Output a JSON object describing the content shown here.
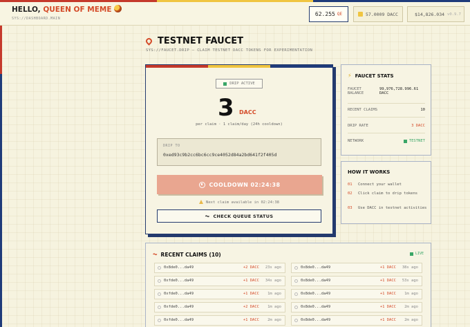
{
  "colors": {
    "red": "#c5392b",
    "navy": "#1f3b7a",
    "yellow": "#f0c540",
    "orange": "#d44a28",
    "green": "#3aa667"
  },
  "header": {
    "greeting": "HELLO, ",
    "user_name": "QUEEN OF MEME",
    "path": "SYS://DASHBOARD.MAIN",
    "balance_value": "62.255",
    "balance_unit": "QE",
    "dacc_balance": "57.0009 DACC",
    "token_amount": "$14,826.034",
    "version": "v0.9.7"
  },
  "page": {
    "title": "TESTNET FAUCET",
    "subtitle": "SYS://FAUCET.DRIP — CLAIM TESTNET DACC TOKENS FOR EXPERIMENTATION"
  },
  "faucet": {
    "status_badge": "DRIP ACTIVE",
    "amount": "3",
    "amount_unit": "DACC",
    "per_claim": "per claim · 1 claim/day (24h cooldown)",
    "drip_to_label": "DRIP TO",
    "address": "0xed93c9b2cc6bc6cc9ce4052d84a2bd641f2f405d",
    "cooldown_button": "COOLDOWN 02:24:38",
    "next_claim": "Next claim available in 02:24:38",
    "queue_button": "CHECK QUEUE STATUS"
  },
  "stats": {
    "title": "FAUCET STATS",
    "rows": [
      {
        "label_line1": "FAUCET",
        "label_line2": "BALANCE",
        "value_line1": "99,976,728.996.61",
        "value_line2": "DACC"
      },
      {
        "label": "RECENT CLAIMS",
        "value": "10"
      },
      {
        "label": "DRIP RATE",
        "value": "3 DACC"
      },
      {
        "label": "NETWORK",
        "value": "TESTNET"
      }
    ]
  },
  "how_it_works": {
    "title": "HOW IT WORKS",
    "steps": [
      {
        "num": "01",
        "text": "Connect your wallet"
      },
      {
        "num": "02",
        "text": "Click claim to drip tokens"
      },
      {
        "num": "03",
        "text": "Use DACC in testnet activities"
      }
    ]
  },
  "recent_claims": {
    "title": "RECENT CLAIMS (10)",
    "live_label": "LIVE",
    "left": [
      {
        "address": "0x8de0...da49",
        "amount": "+2 DACC",
        "time": "23s ago"
      },
      {
        "address": "0xfde0...da49",
        "amount": "+1 DACC",
        "time": "34s ago"
      },
      {
        "address": "0xfde0...da49",
        "amount": "+1 DACC",
        "time": "1m ago"
      },
      {
        "address": "0xfde0...da49",
        "amount": "+2 DACC",
        "time": "1m ago"
      },
      {
        "address": "0xfde0...da49",
        "amount": "+1 DACC",
        "time": "2m ago"
      }
    ],
    "right": [
      {
        "address": "0x8de0...da49",
        "amount": "+1 DACC",
        "time": "38s ago"
      },
      {
        "address": "0x8de0...da49",
        "amount": "+1 DACC",
        "time": "53s ago"
      },
      {
        "address": "0x8de0...da49",
        "amount": "+1 DACC",
        "time": "1m ago"
      },
      {
        "address": "0x8de0...da49",
        "amount": "+1 DACC",
        "time": "2m ago"
      },
      {
        "address": "0x8de0...da49",
        "amount": "+1 DACC",
        "time": "2m ago"
      }
    ]
  }
}
